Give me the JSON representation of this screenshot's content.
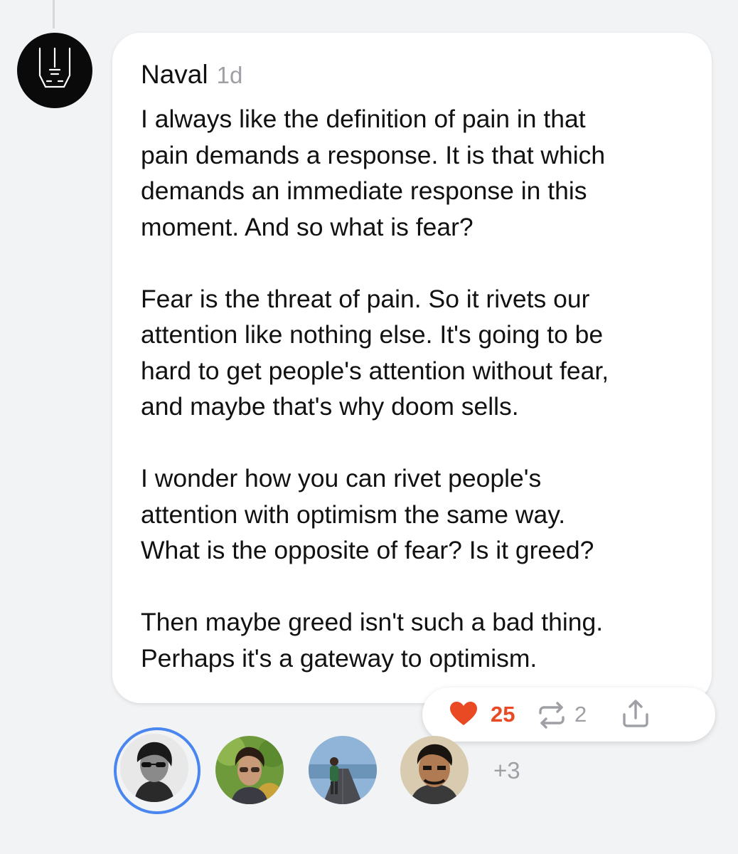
{
  "comment": {
    "author": "Naval",
    "timestamp": "1d",
    "paragraphs": [
      "I always like the definition of pain in that\npain demands a response. It is that which\ndemands an immediate response in this\nmoment. And so what is fear?",
      "Fear is the threat of pain. So it rivets our\nattention like nothing else. It's going to be\nhard to get people's attention without fear,\nand maybe that's why doom sells.",
      "I wonder how you can rivet people's\nattention with optimism the same way.\nWhat is the opposite of fear? Is it greed?",
      "Then maybe greed isn't such a bad thing.\nPerhaps it's a gateway to optimism."
    ]
  },
  "actions": {
    "like_count": "25",
    "restack_count": "2",
    "icons": [
      "heart-icon",
      "restack-icon",
      "share-icon"
    ],
    "like_color": "#e94a24"
  },
  "reactions": {
    "more_label": "+3",
    "selected_ring_color": "#4a86f0"
  }
}
